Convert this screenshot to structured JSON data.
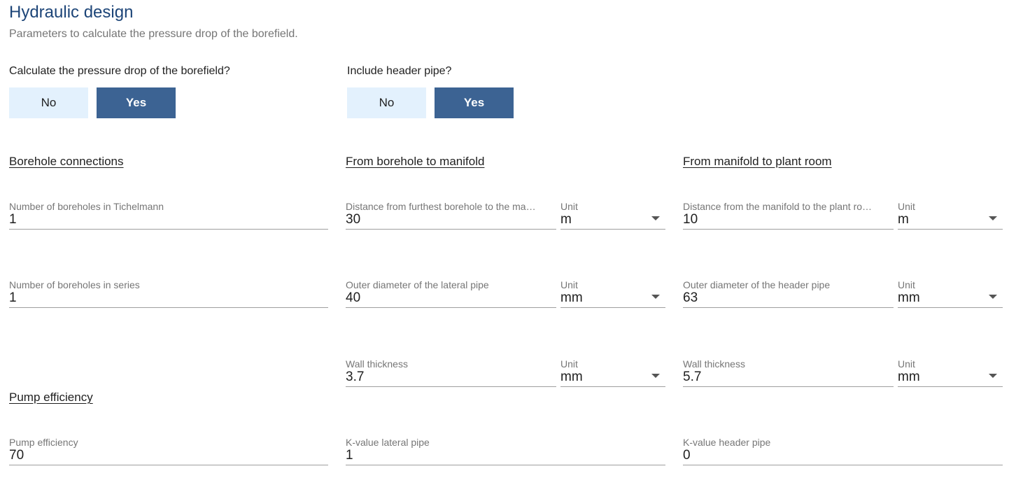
{
  "header": {
    "title": "Hydraulic design",
    "subtitle": "Parameters to calculate the pressure drop of the borefield."
  },
  "calc_pressure_drop": {
    "question": "Calculate the pressure drop of the borefield?",
    "no_label": "No",
    "yes_label": "Yes",
    "selected": "Yes"
  },
  "include_header": {
    "question": "Include header pipe?",
    "no_label": "No",
    "yes_label": "Yes",
    "selected": "Yes"
  },
  "borehole_connections": {
    "heading": "Borehole connections",
    "tichelmann": {
      "label": "Number of boreholes in Tichelmann",
      "value": "1"
    },
    "series": {
      "label": "Number of boreholes in series",
      "value": "1"
    }
  },
  "pump": {
    "heading": "Pump efficiency",
    "efficiency": {
      "label": "Pump efficiency",
      "value": "70"
    }
  },
  "borehole_to_manifold": {
    "heading": "From borehole to manifold",
    "distance": {
      "label": "Distance from furthest borehole to the ma…",
      "value": "30",
      "unit_label": "Unit",
      "unit": "m"
    },
    "outer_diameter": {
      "label": "Outer diameter of the lateral pipe",
      "value": "40",
      "unit_label": "Unit",
      "unit": "mm"
    },
    "wall_thickness": {
      "label": "Wall thickness",
      "value": "3.7",
      "unit_label": "Unit",
      "unit": "mm"
    },
    "k_value": {
      "label": "K-value lateral pipe",
      "value": "1"
    }
  },
  "manifold_to_plant": {
    "heading": "From manifold to plant room",
    "distance": {
      "label": "Distance from the manifold to the plant ro…",
      "value": "10",
      "unit_label": "Unit",
      "unit": "m"
    },
    "outer_diameter": {
      "label": "Outer diameter of the header pipe",
      "value": "63",
      "unit_label": "Unit",
      "unit": "mm"
    },
    "wall_thickness": {
      "label": "Wall thickness",
      "value": "5.7",
      "unit_label": "Unit",
      "unit": "mm"
    },
    "k_value": {
      "label": "K-value header pipe",
      "value": "0"
    }
  },
  "colors": {
    "title": "#1d4578",
    "toggle_on": "#3c6393",
    "toggle_off": "#e3f1fd"
  },
  "icons": {
    "dropdown": "caret-down-icon"
  }
}
